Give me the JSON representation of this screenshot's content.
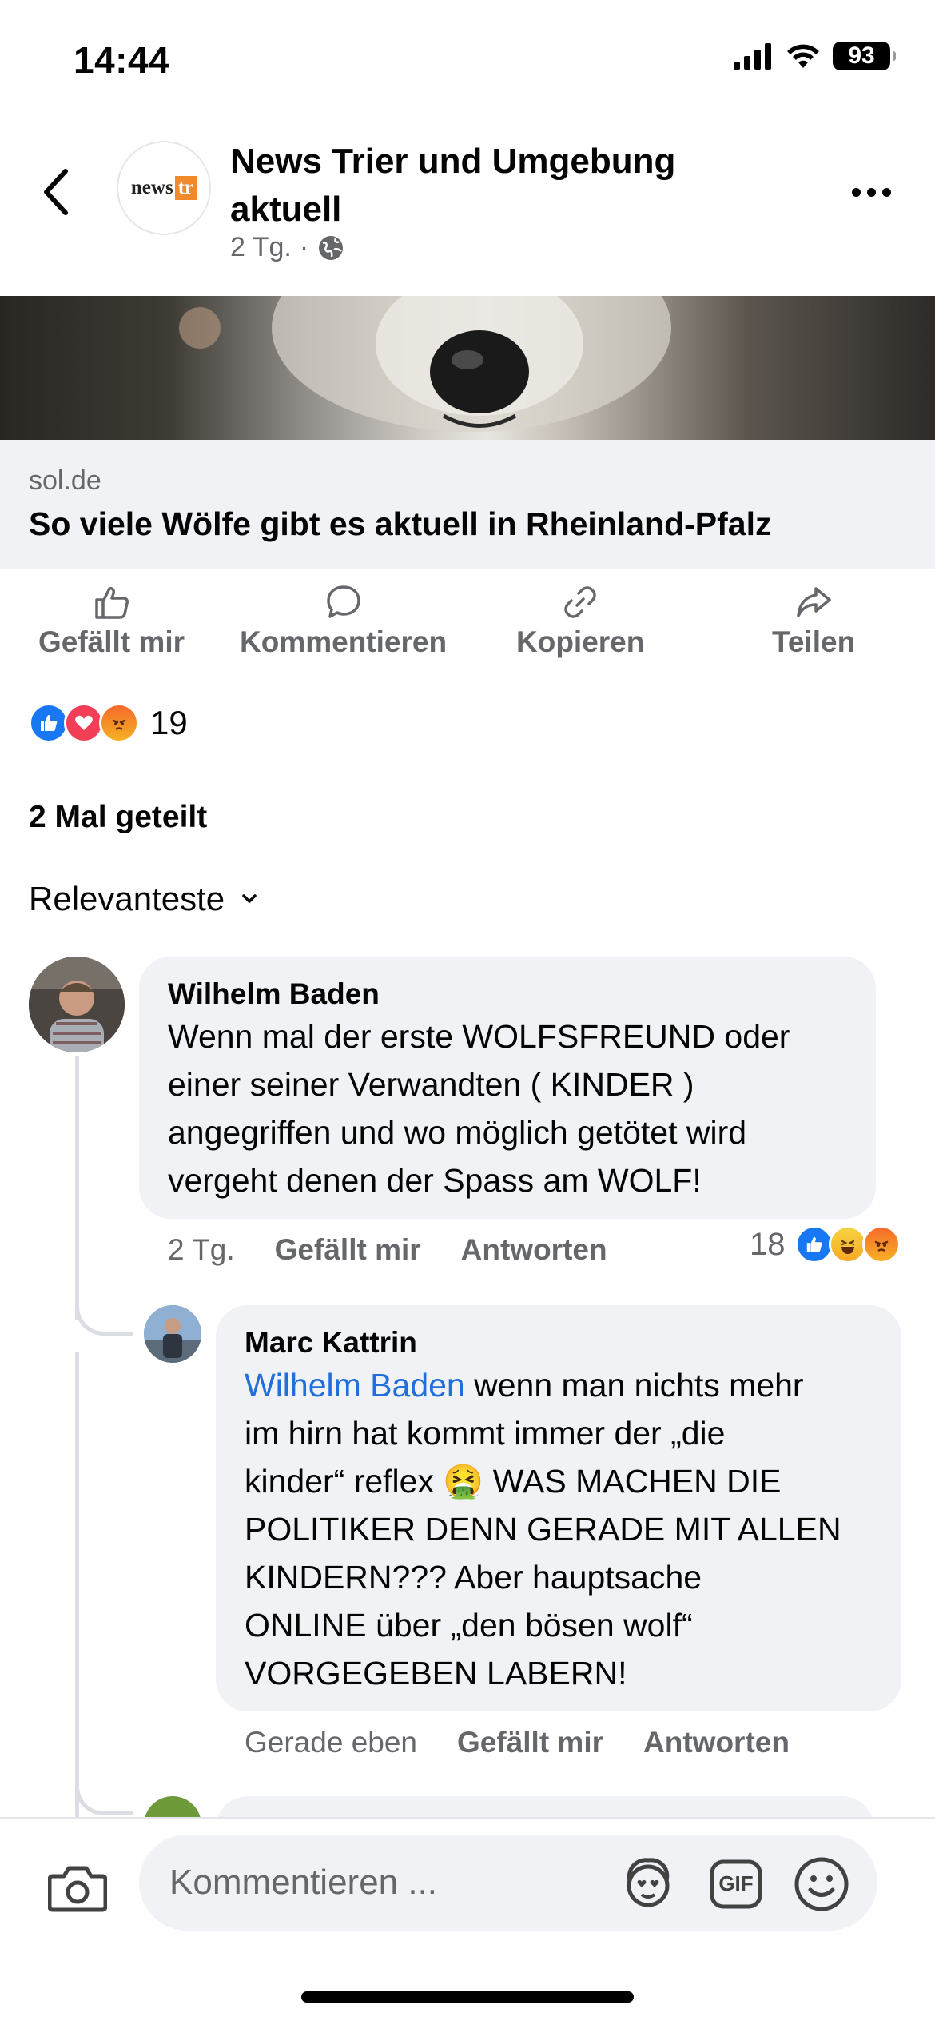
{
  "status_bar": {
    "time": "14:44",
    "battery": "93"
  },
  "header": {
    "page_name": "News Trier und Umgebung aktuell",
    "logo_text": "news",
    "logo_box": "tr",
    "time_ago": "2 Tg.",
    "separator": "·"
  },
  "link_preview": {
    "domain": "sol.de",
    "title": "So viele Wölfe gibt es aktuell in Rheinland-Pfalz"
  },
  "actions": {
    "like": "Gefällt mir",
    "comment": "Kommentieren",
    "copy": "Kopieren",
    "share": "Teilen"
  },
  "reactions": {
    "count": "19",
    "types": [
      "like",
      "love",
      "angry"
    ]
  },
  "shares": "2 Mal geteilt",
  "sort_label": "Relevanteste",
  "comments": [
    {
      "author": "Wilhelm Baden",
      "text_lines": [
        "Wenn mal der erste WOLFSFREUND oder",
        "einer seiner Verwandten  (  KINDER )",
        "angegriffen und wo möglich getötet wird",
        "vergeht denen der Spass am WOLF!"
      ],
      "time": "2 Tg.",
      "like": "Gefällt mir",
      "reply": "Antworten",
      "reaction_count": "18",
      "reaction_types": [
        "like",
        "haha",
        "angry"
      ]
    },
    {
      "author": "Marc Kattrin",
      "mention": "Wilhelm Baden",
      "text_first": " wenn man nichts mehr",
      "text_lines": [
        "im hirn hat kommt immer der „die",
        "kinder“ reflex 🤮 WAS MACHEN DIE",
        "POLITIKER DENN GERADE MIT ALLEN",
        "KINDERN??? Aber hauptsache",
        "ONLINE über „den bösen wolf“",
        "VORGEGEBEN LABERN!"
      ],
      "time": "Gerade eben",
      "like": "Gefällt mir",
      "reply": "Antworten"
    }
  ],
  "composer": {
    "placeholder": "Kommentieren ...",
    "gif_label": "GIF"
  },
  "colors": {
    "accent": "#1877f2",
    "text_secondary": "#65676b",
    "bubble": "#f0f2f5",
    "mention": "#216fdb"
  }
}
